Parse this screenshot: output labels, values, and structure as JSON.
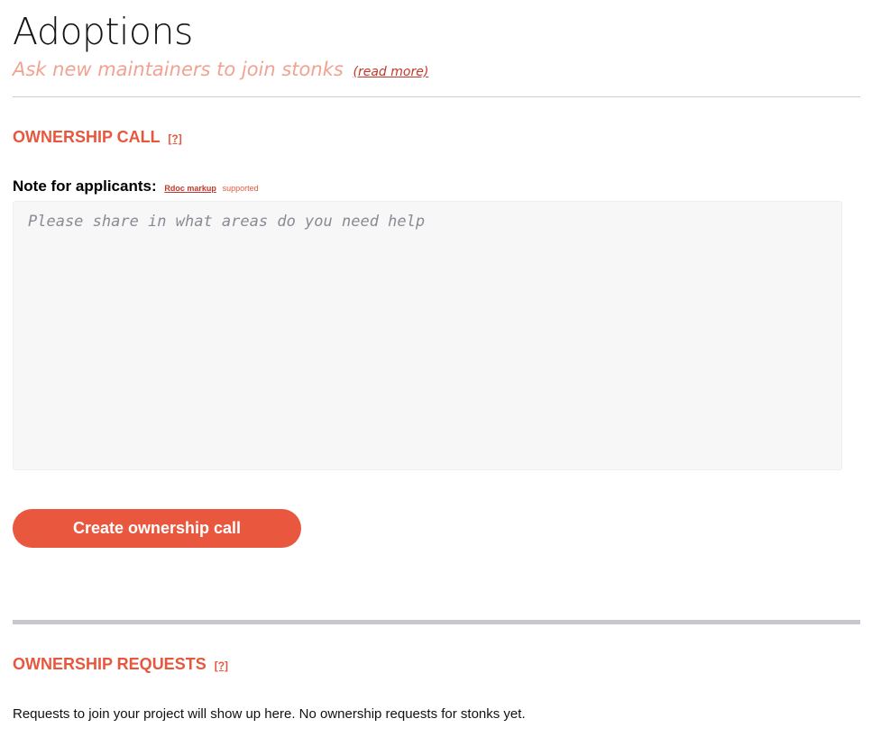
{
  "header": {
    "title": "Adoptions",
    "subtitle": "Ask new maintainers to join stonks",
    "read_more": "(read more)"
  },
  "ownership_call": {
    "heading": "OWNERSHIP CALL",
    "help": "[?]",
    "note_label": "Note for applicants:",
    "rdoc_link": "Rdoc markup",
    "supported": "supported",
    "textarea_placeholder": "Please share in what areas do you need help",
    "textarea_value": "",
    "submit_label": "Create ownership call"
  },
  "ownership_requests": {
    "heading": "OWNERSHIP REQUESTS",
    "help": "[?]",
    "empty_text": "Requests to join your project will show up here. No ownership requests for stonks yet."
  },
  "colors": {
    "accent": "#e9573f",
    "subtitle": "#f1a392",
    "textarea_bg": "#f7f7f7"
  }
}
